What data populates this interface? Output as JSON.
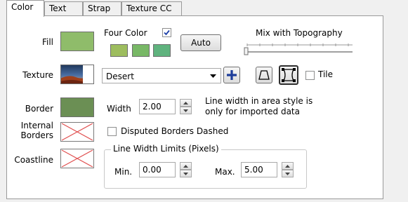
{
  "tabs": [
    "Color",
    "Text",
    "Strap",
    "Texture CC"
  ],
  "fill": {
    "label": "Fill",
    "color": "#8fbc6a"
  },
  "four_color": {
    "label": "Four Color",
    "checked": true,
    "swatches": [
      "#9dbd5e",
      "#78b866",
      "#5fb37e"
    ]
  },
  "auto_button": "Auto",
  "topography": {
    "label": "Mix with Topography",
    "value": 0
  },
  "texture": {
    "label": "Texture",
    "selected": "Desert",
    "tile_label": "Tile",
    "tile_checked": false
  },
  "border": {
    "label": "Border",
    "color": "#6b8f54",
    "width_label": "Width",
    "width_value": "2.00",
    "note_line1": "Line width in area style is",
    "note_line2": "only for imported data"
  },
  "internal_borders": {
    "label_line1": "Internal",
    "label_line2": "Borders"
  },
  "disputed": {
    "label": "Disputed Borders Dashed",
    "checked": false
  },
  "coastline": {
    "label": "Coastline"
  },
  "limits": {
    "title": "Line Width Limits (Pixels)",
    "min_label": "Min.",
    "min_value": "0.00",
    "max_label": "Max.",
    "max_value": "5.00"
  }
}
